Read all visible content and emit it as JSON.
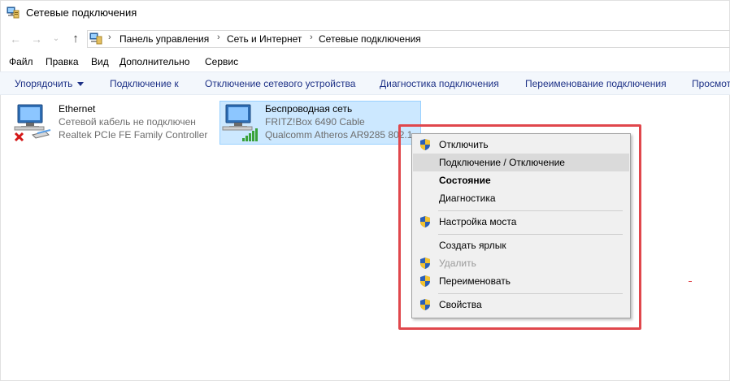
{
  "window": {
    "title": "Сетевые подключения"
  },
  "nav": {
    "back_icon": "arrow-left-icon",
    "forward_icon": "arrow-right-icon",
    "recent_icon": "chevron-down-icon",
    "up_icon": "arrow-up-icon",
    "breadcrumb": [
      "Панель управления",
      "Сеть и Интернет",
      "Сетевые подключения"
    ]
  },
  "menubar": [
    "Файл",
    "Правка",
    "Вид",
    "Дополнительно",
    "Сервис"
  ],
  "commandbar": {
    "organize": "Упорядочить",
    "items": [
      "Подключение к",
      "Отключение сетевого устройства",
      "Диагностика подключения",
      "Переименование подключения",
      "Просмот"
    ]
  },
  "connections": [
    {
      "name": "Ethernet",
      "status": "Сетевой кабель не подключен",
      "device": "Realtek PCIe FE Family Controller",
      "icon": "wired-network-disconnected-icon"
    },
    {
      "name": "Беспроводная сеть",
      "status": "FRITZ!Box 6490 Cable",
      "device": "Qualcomm Atheros AR9285 802.1...",
      "icon": "wireless-network-icon",
      "selected": true
    }
  ],
  "context_menu": {
    "items": [
      {
        "label": "Отключить",
        "shield": true
      },
      {
        "label": "Подключение / Отключение",
        "highlighted": true
      },
      {
        "label": "Состояние",
        "bold": true
      },
      {
        "label": "Диагностика"
      },
      {
        "label": "Настройка моста",
        "shield": true
      },
      {
        "label": "Создать ярлык"
      },
      {
        "label": "Удалить",
        "shield": true,
        "disabled": true
      },
      {
        "label": "Переименовать",
        "shield": true
      },
      {
        "label": "Свойства",
        "shield": true
      }
    ]
  },
  "colors": {
    "accent_frame": "#e0474c",
    "selection": "#cce8ff",
    "command_text": "#1e3287"
  }
}
